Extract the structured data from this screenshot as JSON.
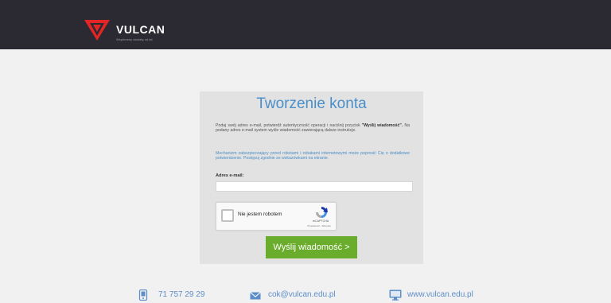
{
  "brand": {
    "name": "VULCAN",
    "tagline": "Wspieramy oświatę od lat",
    "red": "#e32525",
    "accent_blue": "#4a8fc9",
    "accent_green": "#6aac2c"
  },
  "form": {
    "title": "Tworzenie konta",
    "instr_prefix": "Podaj swój adres e-mail, potwierdź autentyczność operacji i naciśnij przycisk",
    "instr_action": "\"Wyślij wiadomość\".",
    "instr_suffix": "Na podany adres e-mail system wyśle wiadomość zawierającą dalsze instrukcje.",
    "robot_note": "Mechanizm zabezpieczający przed robotami i robakami internetowymi może poprosić Cię o dodatkowe potwierdzenie. Postępuj zgodnie ze wskazówkami na ekranie.",
    "email_label": "Adres e-mail:",
    "email_value": "",
    "captcha": {
      "label": "Nie jestem robotem",
      "brand": "reCAPTCHA",
      "links": "Prywatność - Warunki",
      "checked": false
    },
    "submit_label": "Wyślij wiadomość >"
  },
  "footer": {
    "phone": "71 757 29 29",
    "email": "cok@vulcan.edu.pl",
    "website": "www.vulcan.edu.pl",
    "icons": [
      "phone-icon",
      "envelope-icon",
      "monitor-icon"
    ]
  }
}
